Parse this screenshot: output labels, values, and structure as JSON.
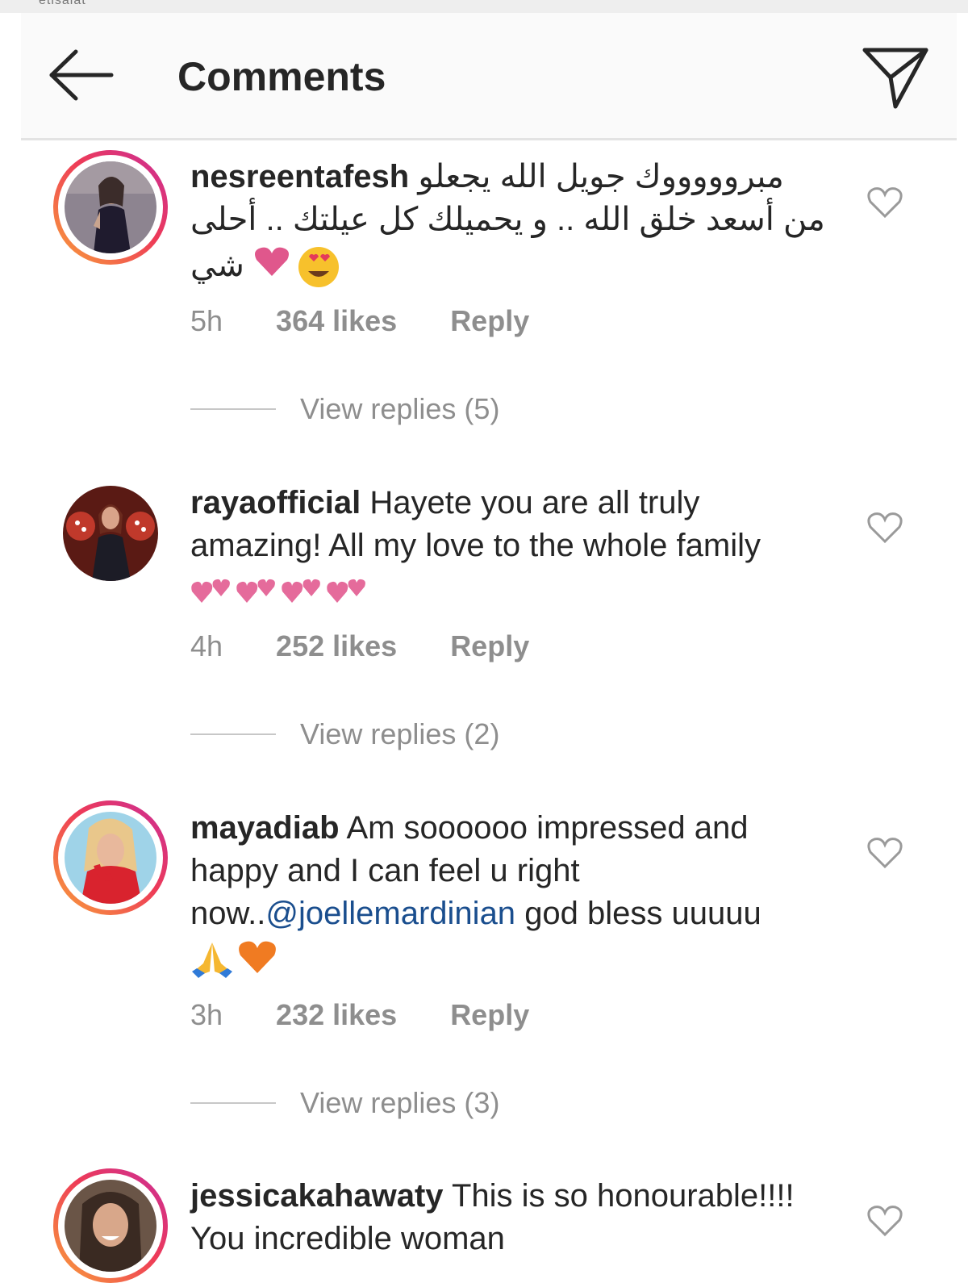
{
  "status_bar": {
    "carrier_text": "etisalat"
  },
  "header": {
    "title": "Comments",
    "back_icon": "arrow-left-icon",
    "send_icon": "paper-plane-icon"
  },
  "comments": [
    {
      "username": "nesreentafesh",
      "text_line1": "مبروووووك جويل الله يجعلو",
      "text_line2": "من أسعد خلق الله .. و يحميلك كل عيلتك .. أحلى",
      "text_line3": "شي",
      "emojis": [
        "pink-heart-emoji",
        "heart-eyes-emoji"
      ],
      "time": "5h",
      "likes": "364 likes",
      "reply_label": "Reply",
      "view_replies": "View replies (5)",
      "avatar_ring": true
    },
    {
      "username": "rayaofficial",
      "text": "Hayete you are all truly amazing! All my love to the whole family",
      "emojis": [
        "two-hearts-emoji",
        "two-hearts-emoji",
        "two-hearts-emoji",
        "two-hearts-emoji"
      ],
      "time": "4h",
      "likes": "252 likes",
      "reply_label": "Reply",
      "view_replies": "View replies (2)",
      "avatar_ring": false
    },
    {
      "username": "mayadiab",
      "text_before_mention": "Am soooooo impressed and happy and I can feel u right now..",
      "mention": "@joellemardinian",
      "text_after_mention": "god bless uuuuu",
      "emojis": [
        "folded-hands-emoji",
        "orange-heart-emoji"
      ],
      "time": "3h",
      "likes": "232 likes",
      "reply_label": "Reply",
      "view_replies": "View replies (3)",
      "avatar_ring": true
    },
    {
      "username": "jessicakahawaty",
      "text": "This is so honourable!!!! You incredible woman",
      "avatar_ring": true
    }
  ],
  "colors": {
    "accent_link": "#1a4e8e",
    "meta_gray": "#8e8e8e",
    "ring_start": "#f9a23a",
    "ring_mid": "#ee3b57",
    "ring_end": "#c92d9a"
  }
}
